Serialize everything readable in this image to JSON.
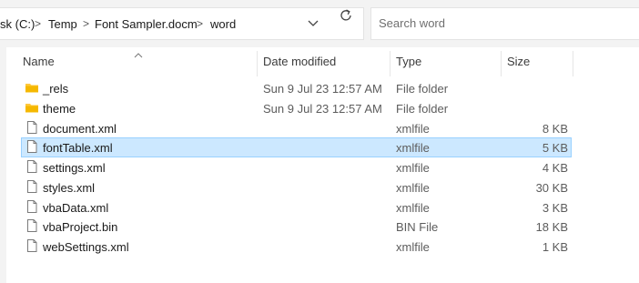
{
  "address": {
    "crumbs": [
      "sk (C:)",
      "Temp",
      "Font Sampler.docm",
      "word"
    ],
    "separator": ">"
  },
  "search": {
    "placeholder": "Search word"
  },
  "columns": {
    "name": "Name",
    "date": "Date modified",
    "type": "Type",
    "size": "Size"
  },
  "files": [
    {
      "name": "_rels",
      "date": "Sun 9 Jul 23 12:57 AM",
      "type": "File folder",
      "size": "",
      "icon": "folder-icon"
    },
    {
      "name": "theme",
      "date": "Sun 9 Jul 23 12:57 AM",
      "type": "File folder",
      "size": "",
      "icon": "folder-icon"
    },
    {
      "name": "document.xml",
      "date": "",
      "type": "xmlfile",
      "size": "8 KB",
      "icon": "file-icon"
    },
    {
      "name": "fontTable.xml",
      "date": "",
      "type": "xmlfile",
      "size": "5 KB",
      "icon": "file-icon",
      "selected": true
    },
    {
      "name": "settings.xml",
      "date": "",
      "type": "xmlfile",
      "size": "4 KB",
      "icon": "file-icon"
    },
    {
      "name": "styles.xml",
      "date": "",
      "type": "xmlfile",
      "size": "30 KB",
      "icon": "file-icon"
    },
    {
      "name": "vbaData.xml",
      "date": "",
      "type": "xmlfile",
      "size": "3 KB",
      "icon": "file-icon"
    },
    {
      "name": "vbaProject.bin",
      "date": "",
      "type": "BIN File",
      "size": "18 KB",
      "icon": "file-icon"
    },
    {
      "name": "webSettings.xml",
      "date": "",
      "type": "xmlfile",
      "size": "1 KB",
      "icon": "file-icon"
    }
  ],
  "colors": {
    "selection": "#cce8ff",
    "selection_border": "#99d1ff",
    "folder": "#ffc83d"
  }
}
